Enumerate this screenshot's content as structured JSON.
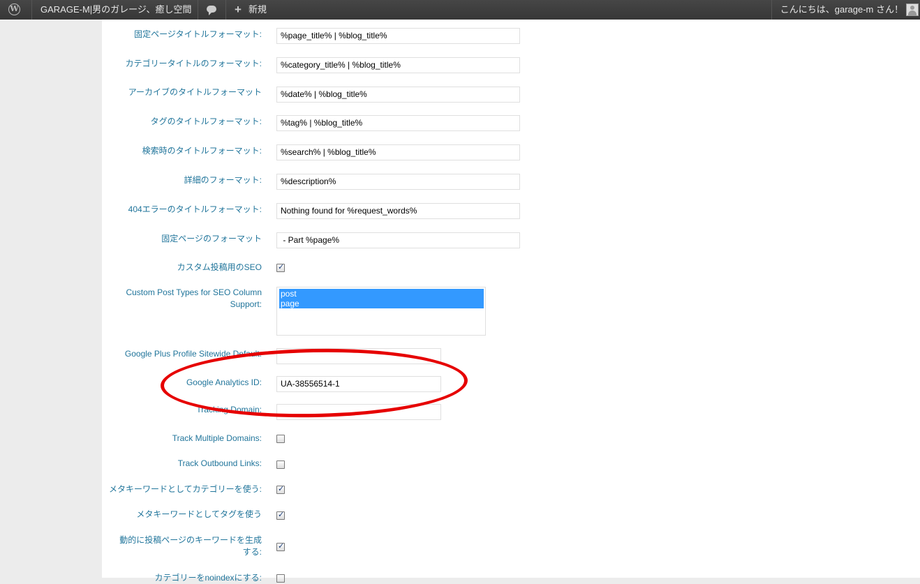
{
  "adminbar": {
    "wp_logo": "wordpress-icon",
    "site_name": "GARAGE-M|男のガレージ、癒し空間",
    "comments_icon": "comment-bubble-icon",
    "new_label": "新規",
    "greeting": "こんにちは、garage-m さん！"
  },
  "fields": {
    "page_title_format": {
      "label": "固定ページタイトルフォーマット:",
      "value": "%page_title% | %blog_title%"
    },
    "category_title_format": {
      "label": "カテゴリータイトルのフォーマット:",
      "value": "%category_title% | %blog_title%"
    },
    "archive_title_format": {
      "label": "アーカイブのタイトルフォーマット",
      "value": "%date% | %blog_title%"
    },
    "tag_title_format": {
      "label": "タグのタイトルフォーマット:",
      "value": "%tag% | %blog_title%"
    },
    "search_title_format": {
      "label": "検索時のタイトルフォーマット:",
      "value": "%search% | %blog_title%"
    },
    "description_format": {
      "label": "詳細のフォーマット:",
      "value": "%description%"
    },
    "404_title_format": {
      "label": "404エラーのタイトルフォーマット:",
      "value": "Nothing found for %request_words%"
    },
    "paged_format": {
      "label": "固定ページのフォーマット",
      "value": " - Part %page%"
    },
    "custom_post_seo": {
      "label": "カスタム投稿用のSEO",
      "checked": true
    },
    "custom_post_types_column": {
      "label": "Custom Post Types for SEO Column Support:",
      "options": [
        "post",
        "page"
      ]
    },
    "google_plus_default": {
      "label": "Google Plus Profile Sitewide Default:",
      "value": ""
    },
    "google_analytics_id": {
      "label": "Google Analytics ID:",
      "value": "UA-38556514-1"
    },
    "tracking_domain": {
      "label": "Tracking Domain:",
      "value": ""
    },
    "track_multiple_domains": {
      "label": "Track Multiple Domains:",
      "checked": false
    },
    "track_outbound_links": {
      "label": "Track Outbound Links:",
      "checked": false
    },
    "use_categories_keywords": {
      "label": "メタキーワードとしてカテゴリーを使う:",
      "checked": true
    },
    "use_tags_keywords": {
      "label": "メタキーワードとしてタグを使う",
      "checked": true
    },
    "dynamic_keywords": {
      "label": "動的に投稿ページのキーワードを生成する:",
      "checked": true
    },
    "category_noindex": {
      "label": "カテゴリーをnoindexにする:",
      "checked": false
    }
  },
  "annotation_color": "#e60000"
}
